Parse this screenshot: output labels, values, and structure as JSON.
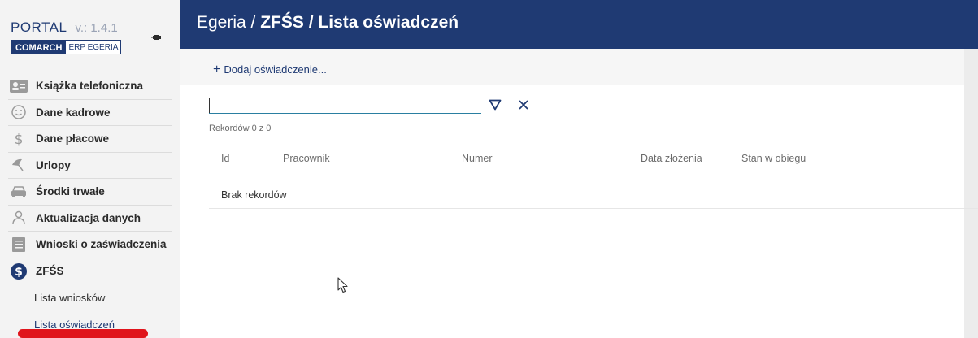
{
  "brand": {
    "portal": "PORTAL",
    "version": "v.: 1.4.1",
    "logo_left": "COMARCH",
    "logo_right": "ERP EGERIA"
  },
  "sidebar": {
    "items": [
      {
        "label": "Książka telefoniczna",
        "icon": "contact-card-icon"
      },
      {
        "label": "Dane kadrowe",
        "icon": "face-icon"
      },
      {
        "label": "Dane płacowe",
        "icon": "dollar-icon"
      },
      {
        "label": "Urlopy",
        "icon": "umbrella-icon"
      },
      {
        "label": "Środki trwałe",
        "icon": "car-icon"
      },
      {
        "label": "Aktualizacja danych",
        "icon": "person-icon"
      },
      {
        "label": "Wnioski o zaświadczenia",
        "icon": "document-icon"
      },
      {
        "label": "ZFŚS",
        "icon": "dollar-circle-icon"
      }
    ],
    "subitems": [
      {
        "label": "Lista wniosków"
      },
      {
        "label": "Lista oświadczeń",
        "active": true
      }
    ]
  },
  "header": {
    "crumb_root": "Egeria / ",
    "crumb_section": "ZFŚS",
    "crumb_sep": " / ",
    "crumb_page": "Lista oświadczeń"
  },
  "toolbar": {
    "add_label": "Dodaj oświadczenie..."
  },
  "search": {
    "value": "",
    "placeholder": ""
  },
  "records_label": "Rekordów 0 z 0",
  "table": {
    "columns": [
      "Id",
      "Pracownik",
      "Numer",
      "Data złożenia",
      "Stan w obiegu"
    ],
    "empty_label": "Brak rekordów"
  },
  "colors": {
    "header_bg": "#1f3a73",
    "accent_underline": "#2a7fa1",
    "annotation_red": "#e0141b"
  }
}
